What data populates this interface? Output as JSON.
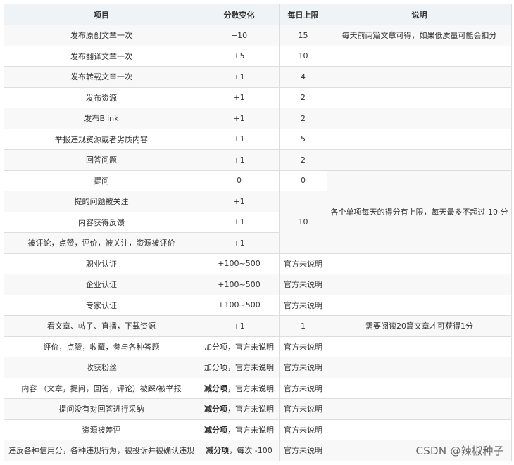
{
  "table": {
    "headers": [
      "项目",
      "分数变化",
      "每日上限",
      "说明"
    ],
    "rows": [
      [
        "发布原创文章一次",
        "+10",
        "15",
        "每天前两篇文章可得，如果低质量可能会扣分"
      ],
      [
        "发布翻译文章一次",
        "+5",
        "10",
        ""
      ],
      [
        "发布转载文章一次",
        "+1",
        "4",
        ""
      ],
      [
        "发布资源",
        "+1",
        "2",
        ""
      ],
      [
        "发布Blink",
        "+1",
        "2",
        ""
      ],
      [
        "举报违规资源或者劣质内容",
        "+1",
        "5",
        ""
      ],
      [
        "回答问题",
        "+1",
        "2",
        ""
      ],
      [
        "提问",
        "0",
        "0",
        ""
      ],
      [
        "提的问题被关注",
        "+1",
        "10",
        "各个单项每天的得分有上限，每天最多不超过 10 分"
      ],
      [
        "内容获得反馈",
        "+1",
        "",
        ""
      ],
      [
        "被评论，点赞，评价，被关注，资源被评价",
        "+1",
        "",
        ""
      ],
      [
        "职业认证",
        "+100~500",
        "官方未说明",
        ""
      ],
      [
        "企业认证",
        "+100~500",
        "官方未说明",
        ""
      ],
      [
        "专家认证",
        "+100~500",
        "官方未说明",
        ""
      ],
      [
        "看文章、帖子、直播，下载资源",
        "+1",
        "1",
        "需要阅读20篇文章才可获得1分"
      ],
      [
        "评价，点赞，收藏，参与各种答题",
        "加分项，官方未说明",
        "官方未说明",
        ""
      ],
      [
        "收获粉丝",
        "加分项，官方未说明",
        "官方未说明",
        ""
      ],
      [
        "内容 （文章，提问，回答，评论）被踩/被举报",
        "减分项，官方未说明",
        "官方未说明",
        ""
      ],
      [
        "提问没有对回答进行采纳",
        "减分项，官方未说明",
        "官方未说明",
        ""
      ],
      [
        "资源被差评",
        "减分项，官方未说明",
        "官方未说明",
        ""
      ],
      [
        "违反各种信用分，各种违规行为，被投诉并被确认违规",
        "减分项，每次 -100",
        "官方未说明",
        ""
      ]
    ],
    "neg_prefix": "减分项"
  },
  "watermark": "CSDN @辣椒种子"
}
